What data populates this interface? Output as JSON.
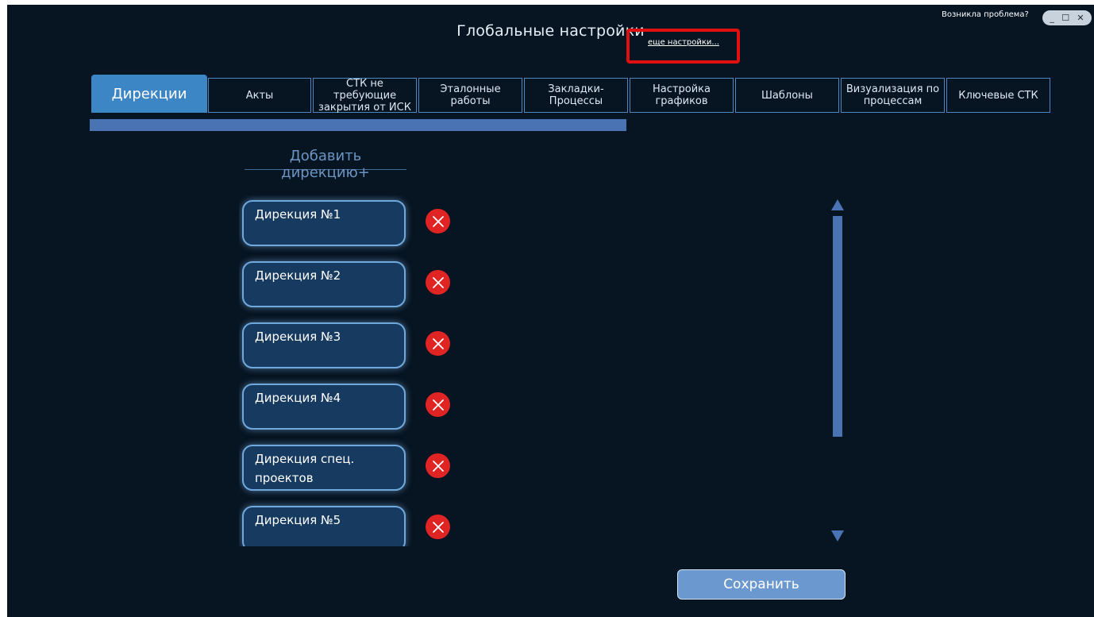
{
  "header": {
    "title": "Глобальные настройки",
    "more_settings_link": "еще настройки...",
    "problem_link": "Возникла проблема?",
    "window_controls": {
      "minimize": "_",
      "maximize": "☐",
      "close": "✕"
    }
  },
  "tabs": [
    {
      "label": "Дирекции",
      "active": true
    },
    {
      "label": "Акты",
      "active": false
    },
    {
      "label": "СТК не требующие закрытия от ИСК",
      "active": false
    },
    {
      "label": "Эталонные работы",
      "active": false
    },
    {
      "label": "Закладки-Процессы",
      "active": false
    },
    {
      "label": "Настройка графиков",
      "active": false
    },
    {
      "label": "Шаблоны",
      "active": false
    },
    {
      "label": "Визуализация по процессам",
      "active": false
    },
    {
      "label": "Ключевые СТК",
      "active": false
    }
  ],
  "main": {
    "add_direction_label": "Добавить дирекцию+",
    "directions": [
      "Дирекция №1",
      "Дирекция №2",
      "Дирекция №3",
      "Дирекция №4",
      "Дирекция спец. проектов",
      "Дирекция №5"
    ],
    "save_label": "Сохранить"
  },
  "colors": {
    "background": "#071421",
    "accent": "#3d86c6",
    "delete": "#e02424",
    "highlight": "#e01010"
  },
  "icons": {
    "delete": "close-circle-icon",
    "scroll_up": "triangle-up-icon",
    "scroll_down": "triangle-down-icon"
  }
}
